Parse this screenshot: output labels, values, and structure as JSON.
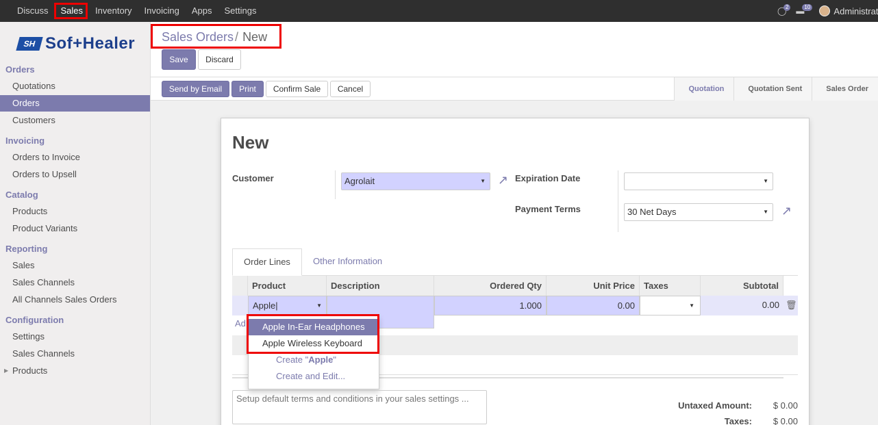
{
  "topbar": {
    "menu": [
      "Discuss",
      "Sales",
      "Inventory",
      "Invoicing",
      "Apps",
      "Settings"
    ],
    "active": "Sales",
    "chat_count": "2",
    "activity_count": "10",
    "user": "Administrator"
  },
  "sidebar": {
    "logo": "Sof+Healer",
    "logo_mark": "SH",
    "sections": [
      {
        "title": "Orders",
        "items": [
          "Quotations",
          "Orders",
          "Customers"
        ]
      },
      {
        "title": "Invoicing",
        "items": [
          "Orders to Invoice",
          "Orders to Upsell"
        ]
      },
      {
        "title": "Catalog",
        "items": [
          "Products",
          "Product Variants"
        ]
      },
      {
        "title": "Reporting",
        "items": [
          "Sales",
          "Sales Channels",
          "All Channels Sales Orders"
        ]
      },
      {
        "title": "Configuration",
        "items": [
          "Settings",
          "Sales Channels",
          "Products"
        ]
      }
    ],
    "active_item": "Orders"
  },
  "breadcrumb": {
    "parent": "Sales Orders",
    "sep": "/",
    "current": "New"
  },
  "buttons": {
    "save": "Save",
    "discard": "Discard",
    "send_email": "Send by Email",
    "print": "Print",
    "confirm": "Confirm Sale",
    "cancel": "Cancel"
  },
  "stages": [
    "Quotation",
    "Quotation Sent",
    "Sales Order"
  ],
  "current_stage": "Quotation",
  "form": {
    "title": "New",
    "customer_label": "Customer",
    "customer_value": "Agrolait",
    "expiration_label": "Expiration Date",
    "expiration_value": "",
    "payment_terms_label": "Payment Terms",
    "payment_terms_value": "30 Net Days"
  },
  "tabs": [
    "Order Lines",
    "Other Information"
  ],
  "grid": {
    "headers": [
      "Product",
      "Description",
      "Ordered Qty",
      "Unit Price",
      "Taxes",
      "Subtotal"
    ],
    "row": {
      "product": "Apple",
      "description": "",
      "qty": "1.000",
      "price": "0.00",
      "taxes": "",
      "subtotal": "0.00"
    },
    "add_item_partial": "Ad"
  },
  "dropdown": {
    "options": [
      "Apple In-Ear Headphones",
      "Apple Wireless Keyboard"
    ],
    "create_prefix": "Create \"",
    "create_term": "Apple",
    "create_suffix": "\"",
    "create_edit": "Create and Edit..."
  },
  "notes_placeholder": "Setup default terms and conditions in your sales settings ...",
  "totals": {
    "untaxed_label": "Untaxed Amount:",
    "untaxed_value": "$ 0.00",
    "taxes_label": "Taxes:",
    "taxes_value": "$ 0.00"
  },
  "colors": {
    "accent": "#7c7bad",
    "highlight": "#ee0000",
    "navbar": "#2f2f2f"
  }
}
